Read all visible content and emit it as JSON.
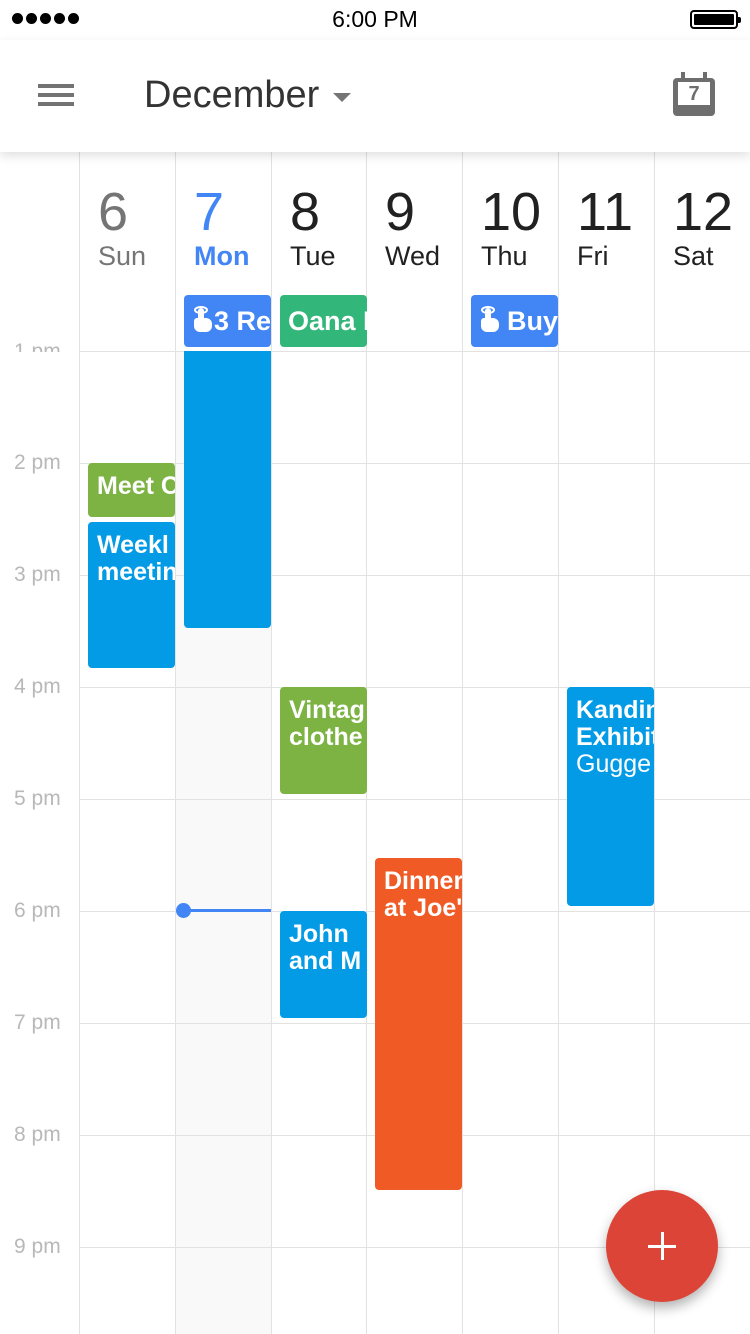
{
  "status_bar": {
    "time": "6:00 PM",
    "signal_dots": 5,
    "battery": "full"
  },
  "app_bar": {
    "menu_icon": "hamburger-menu-icon",
    "month": "December",
    "dropdown_icon": "caret-down-icon",
    "today_icon": "calendar-today-icon",
    "today_number": "7"
  },
  "days": [
    {
      "num": "6",
      "name": "Sun",
      "state": "past"
    },
    {
      "num": "7",
      "name": "Mon",
      "state": "today"
    },
    {
      "num": "8",
      "name": "Tue",
      "state": "future"
    },
    {
      "num": "9",
      "name": "Wed",
      "state": "future"
    },
    {
      "num": "10",
      "name": "Thu",
      "state": "future"
    },
    {
      "num": "11",
      "name": "Fri",
      "state": "future"
    },
    {
      "num": "12",
      "name": "Sat",
      "state": "future"
    }
  ],
  "all_day_events": [
    {
      "day": "Mon",
      "label": "3 Re",
      "icon": "reminder-hand-icon",
      "color": "#4285f4"
    },
    {
      "day": "Tue",
      "label": "Oana I",
      "icon": null,
      "color": "#33b679"
    },
    {
      "day": "Thu",
      "label": "Buy",
      "icon": "reminder-hand-icon",
      "color": "#4285f4"
    }
  ],
  "hours": [
    "1 pm",
    "2 pm",
    "3 pm",
    "4 pm",
    "5 pm",
    "6 pm",
    "7 pm",
    "8 pm",
    "9 pm"
  ],
  "events": [
    {
      "day": "Sun",
      "title": "Meet C",
      "location": "",
      "color": "#7cb342"
    },
    {
      "day": "Sun",
      "title": "Weekl\nmeetin",
      "location": "",
      "color": "#039be5"
    },
    {
      "day": "Mon",
      "title": "",
      "location": "",
      "color": "#039be5"
    },
    {
      "day": "Tue",
      "title": "Vintag\nclothe",
      "location": "",
      "color": "#7cb342"
    },
    {
      "day": "Tue",
      "title": "John\nand M",
      "location": "",
      "color": "#039be5"
    },
    {
      "day": "Wed",
      "title": "Dinner\nat Joe'",
      "location": "",
      "color": "#f05a24"
    },
    {
      "day": "Fri",
      "title": "Kandin\nExhibit",
      "location": "Gugge",
      "color": "#039be5"
    }
  ],
  "current_time": "6:00 PM",
  "fab": {
    "icon": "plus-icon",
    "color": "#db4437",
    "label": "Create event"
  }
}
